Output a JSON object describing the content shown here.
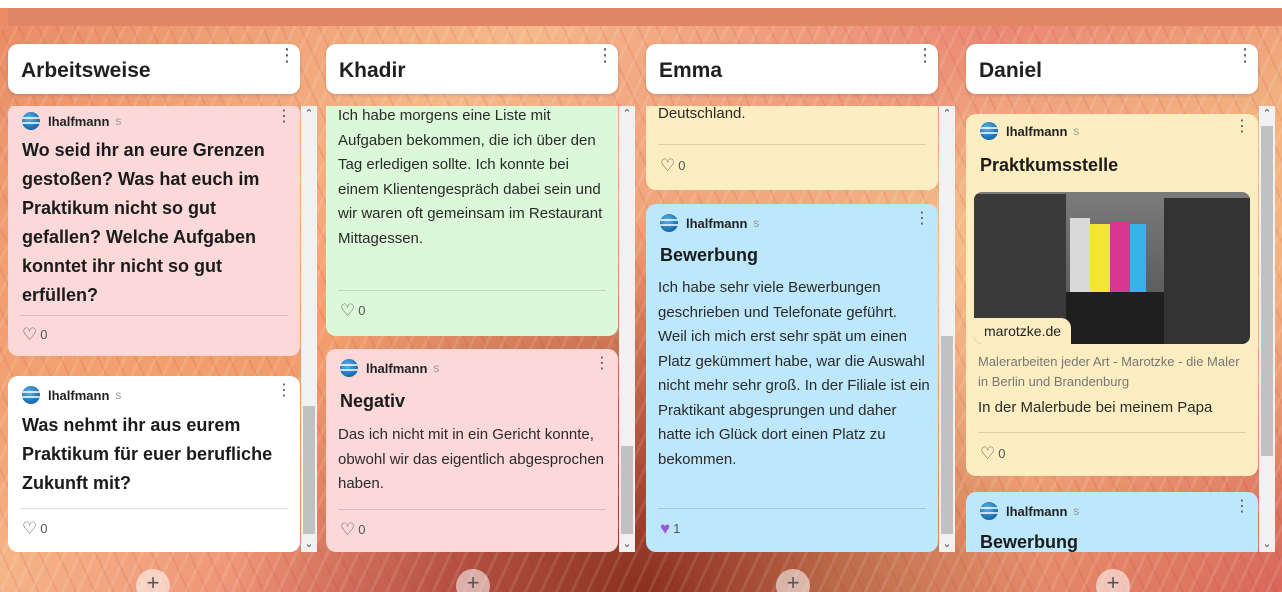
{
  "columns": [
    {
      "title": "Arbeitsweise",
      "cards": [
        {
          "author": "lhalfmann",
          "author_sub": "s",
          "title": "Wo seid ihr an eure Grenzen gestoßen? Was hat euch im Praktikum nicht so gut gefallen? Welche Aufgaben konntet ihr nicht so gut erfüllen?",
          "likes": "0"
        },
        {
          "author": "lhalfmann",
          "author_sub": "s",
          "title": "Was nehmt ihr aus eurem Praktikum für euer berufliche Zukunft mit?",
          "likes": "0"
        }
      ]
    },
    {
      "title": "Khadir",
      "cards": [
        {
          "text": "Ich habe morgens eine Liste mit Aufgaben bekommen, die ich über den Tag erledigen sollte. Ich konnte bei einem Klientengespräch dabei sein und wir waren oft gemeinsam im Restaurant Mittagessen.",
          "likes": "0"
        },
        {
          "author": "lhalfmann",
          "author_sub": "s",
          "title": "Negativ",
          "text": "Das ich nicht mit in ein Gericht konnte, obwohl wir das eigentlich abgesprochen haben.",
          "likes": "0"
        }
      ]
    },
    {
      "title": "Emma",
      "cards": [
        {
          "text": "Deutschland.",
          "likes": "0"
        },
        {
          "author": "lhalfmann",
          "author_sub": "s",
          "title": "Bewerbung",
          "text": "Ich habe sehr viele Bewerbungen geschrieben und Telefonate geführt. Weil ich mich erst sehr spät um einen Platz gekümmert habe, war die Auswahl nicht mehr sehr groß. In der Filiale ist ein Praktikant abgesprungen und daher hatte ich Glück dort einen Platz zu bekommen.",
          "likes": "1"
        }
      ]
    },
    {
      "title": "Daniel",
      "cards": [
        {
          "author": "lhalfmann",
          "author_sub": "s",
          "title": "Praktkumsstelle",
          "link_domain": "marotzke.de",
          "link_description": "Malerarbeiten jeder Art - Marotzke - die Maler in Berlin und Brandenburg",
          "text": "In der Malerbude bei meinem Papa",
          "likes": "0"
        },
        {
          "author": "lhalfmann",
          "author_sub": "s",
          "title": "Bewerbung"
        }
      ]
    }
  ],
  "icons": {
    "kebab": "⋮",
    "heart": "♡",
    "heart_filled": "♥",
    "add": "+",
    "scroll_up": "⌃",
    "scroll_down": "⌄"
  },
  "colors": {
    "pink": "#fcd9d9",
    "green": "#dbf8d9",
    "yellow": "#fdeec2",
    "blue": "#bde7fb",
    "like_active": "#9b59d6"
  }
}
